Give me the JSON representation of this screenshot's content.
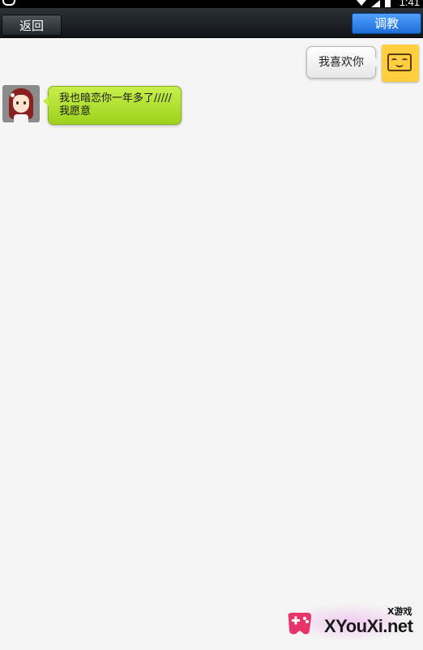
{
  "status_bar": {
    "time": "1:41"
  },
  "toolbar": {
    "back_label": "返回",
    "train_label": "调教",
    "train_color": "#2a7be6"
  },
  "messages": [
    {
      "sender": "me",
      "avatar": "yellow-smiley",
      "text": "我喜欢你"
    },
    {
      "sender": "bot",
      "avatar": "red-haired-girl",
      "lines": [
        "我也暗恋你一年多了/////",
        "我愿意"
      ],
      "bubble_color": "#aee02d"
    }
  ],
  "watermark": {
    "top_text": "X游戏",
    "main_text": "XYouXi.net"
  }
}
